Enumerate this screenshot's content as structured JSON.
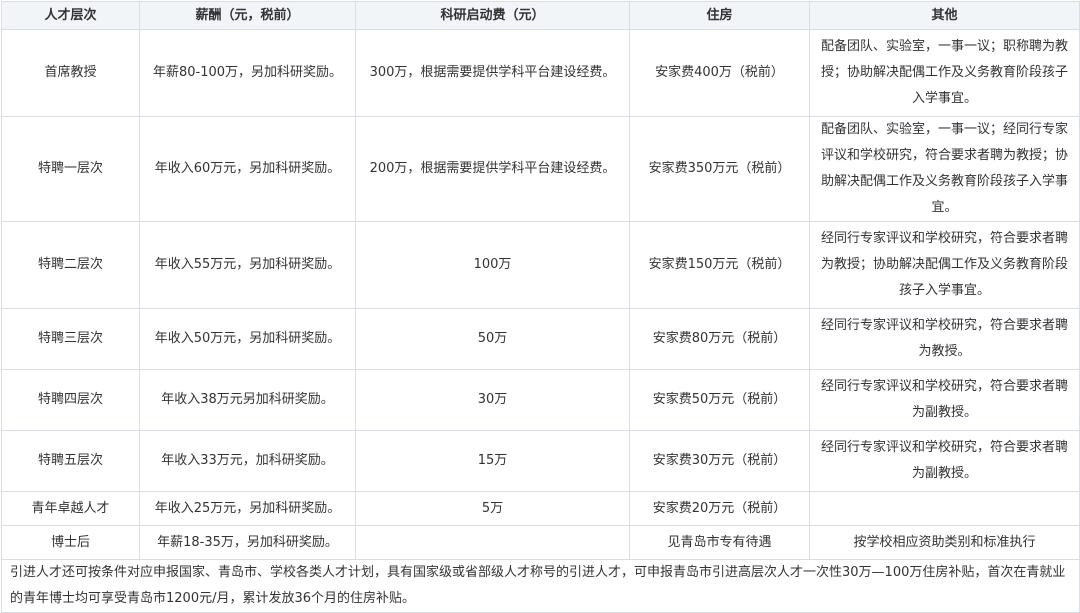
{
  "headers": {
    "level": "人才层次",
    "salary": "薪酬（元，税前）",
    "research": "科研启动费（元）",
    "housing": "住房",
    "other": "其他"
  },
  "rows": [
    {
      "level": "首席教授",
      "salary": "年薪80-100万，另加科研奖励。",
      "research": "300万，根据需要提供学科平台建设经费。",
      "housing": "安家费400万（税前）",
      "other": "配备团队、实验室，一事一议；职称聘为教授；协助解决配偶工作及义务教育阶段孩子入学事宜。"
    },
    {
      "level": "特聘一层次",
      "salary": "年收入60万元，另加科研奖励。",
      "research": "200万，根据需要提供学科平台建设经费。",
      "housing": "安家费350万元（税前）",
      "other": "配备团队、实验室，一事一议；经同行专家评议和学校研究，符合要求者聘为教授；协助解决配偶工作及义务教育阶段孩子入学事宜。"
    },
    {
      "level": "特聘二层次",
      "salary": "年收入55万元，另加科研奖励。",
      "research": "100万",
      "housing": "安家费150万元（税前）",
      "other": "经同行专家评议和学校研究，符合要求者聘为教授；协助解决配偶工作及义务教育阶段孩子入学事宜。"
    },
    {
      "level": "特聘三层次",
      "salary": "年收入50万元，另加科研奖励。",
      "research": "50万",
      "housing": "安家费80万元（税前）",
      "other": "经同行专家评议和学校研究，符合要求者聘为教授。"
    },
    {
      "level": "特聘四层次",
      "salary": "年收入38万元另加科研奖励。",
      "research": "30万",
      "housing": "安家费50万元（税前）",
      "other": "经同行专家评议和学校研究，符合要求者聘为副教授。"
    },
    {
      "level": "特聘五层次",
      "salary": "年收入33万元，加科研奖励。",
      "research": "15万",
      "housing": "安家费30万元（税前）",
      "other": "经同行专家评议和学校研究，符合要求者聘为副教授。"
    },
    {
      "level": "青年卓越人才",
      "salary": "年收入25万元，另加科研奖励。",
      "research": "5万",
      "housing": "安家费20万元（税前）",
      "other": ""
    },
    {
      "level": "博士后",
      "salary": "年薪18-35万，另加科研奖励。",
      "research": "",
      "housing": "见青岛市专有待遇",
      "other": "按学校相应资助类别和标准执行"
    }
  ],
  "note": "引进人才还可按条件对应申报国家、青岛市、学校各类人才计划，具有国家级或省部级人才称号的引进人才，可申报青岛市引进高层次人才一次性30万—100万住房补贴，首次在青就业的青年博士均可享受青岛市1200元/月，累计发放36个月的住房补贴。"
}
